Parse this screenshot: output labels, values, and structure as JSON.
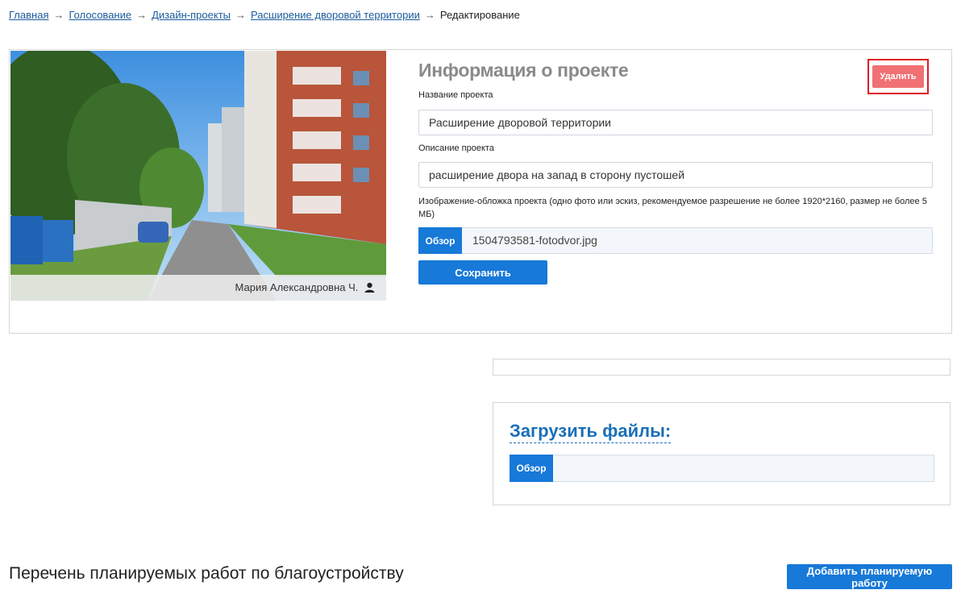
{
  "breadcrumb": {
    "items": [
      "Главная",
      "Голосование",
      "Дизайн-проекты",
      "Расширение дворовой территории"
    ],
    "separator": "→",
    "current": "Редактирование"
  },
  "project": {
    "author": "Мария Александровна Ч.",
    "title": "Информация о проекте",
    "delete_label": "Удалить",
    "name_label": "Название проекта",
    "name_value": "Расширение дворовой территории",
    "description_label": "Описание проекта",
    "description_value": "расширение двора на запад в сторону пустошей",
    "cover_label": "Изображение-обложка проекта (одно фото или эскиз, рекомендуемое разрешение не более 1920*2160, размер не более 5 МБ)",
    "browse_label": "Обзор",
    "file_name": "1504793581-fotodvor.jpg",
    "save_label": "Сохранить"
  },
  "upload": {
    "title": "Загрузить файлы:",
    "browse_label": "Обзор"
  },
  "works": {
    "title": "Перечень планируемых работ по благоустройству",
    "add_label": "Добавить планируемую работу"
  },
  "colors": {
    "primary": "#1779d8",
    "danger": "#f07073",
    "link": "#1a5b9c",
    "highlight": "#e01b24"
  }
}
